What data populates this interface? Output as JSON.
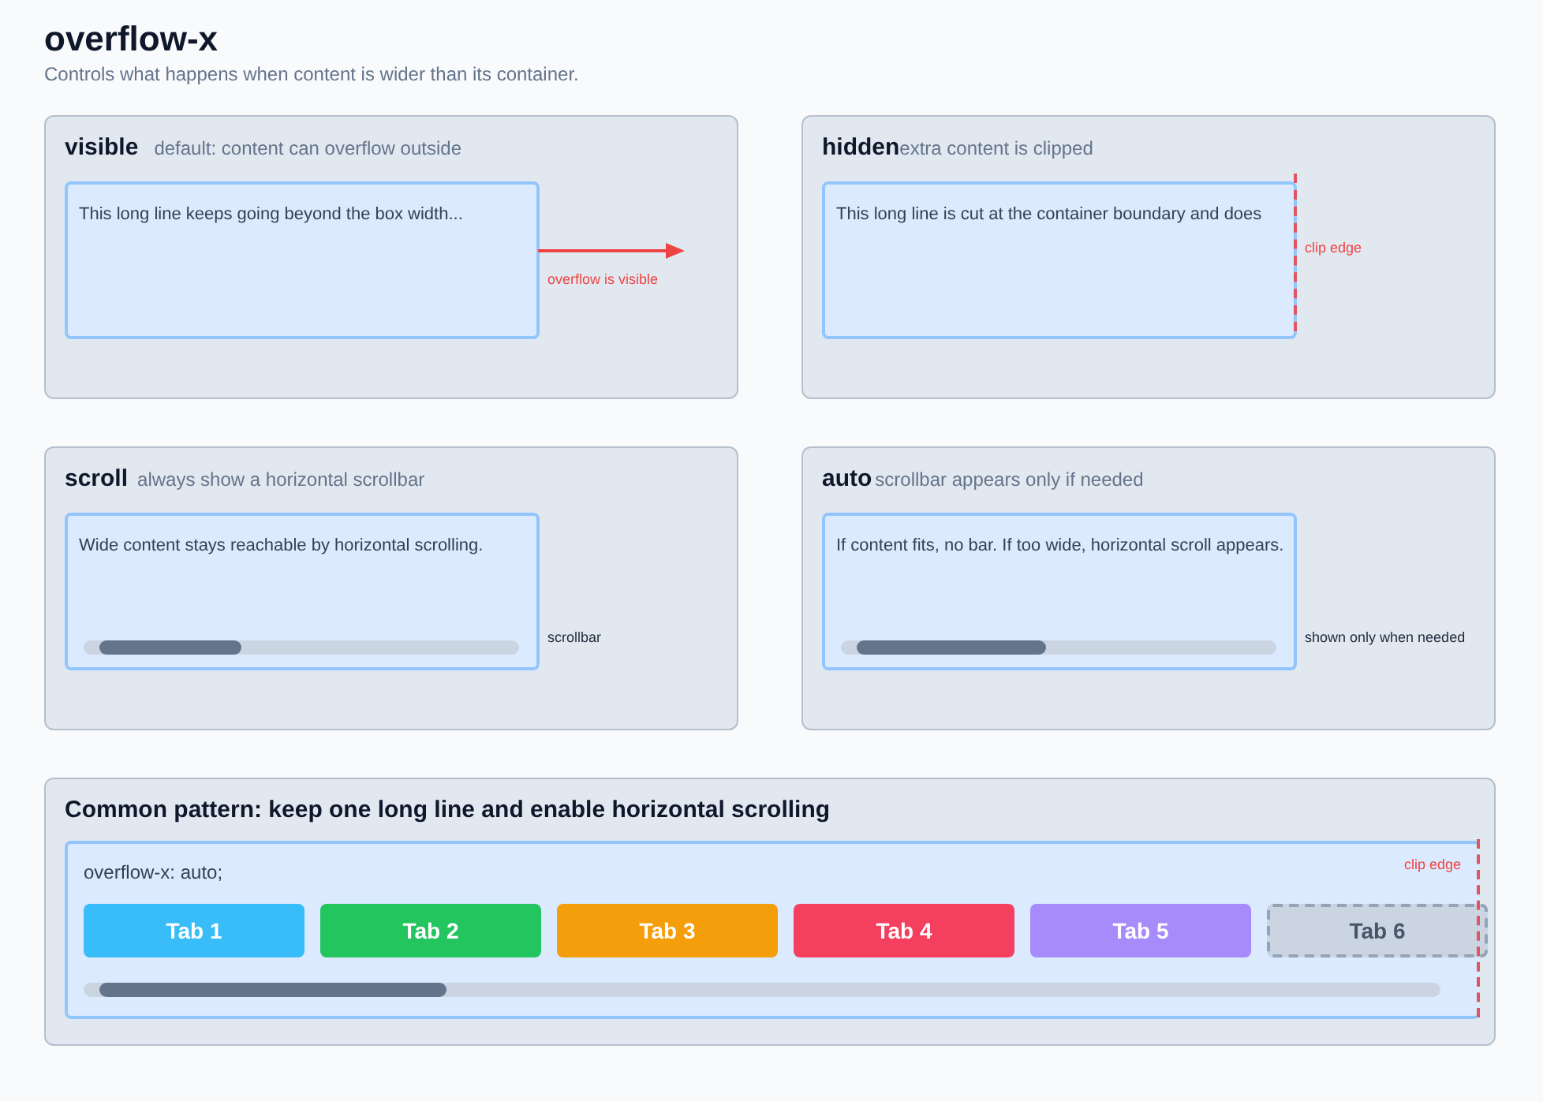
{
  "page": {
    "title": "overflow-x",
    "subtitle": "Controls what happens when content is wider than its container."
  },
  "cards": [
    {
      "kind": "visible",
      "value": "visible",
      "description": "default: content can overflow outside",
      "content": "This long line keeps going beyond the box width...",
      "annotation": "overflow is visible"
    },
    {
      "kind": "hidden",
      "value": "hidden",
      "description": "extra content is clipped",
      "content": "This long line is cut at the container boundary and does",
      "annotation": "clip edge"
    },
    {
      "kind": "scroll",
      "value": "scroll",
      "description": "always show a horizontal scrollbar",
      "content": "Wide content stays reachable by horizontal scrolling.",
      "annotation": "scrollbar"
    },
    {
      "kind": "auto",
      "value": "auto",
      "description": "scrollbar appears only if needed",
      "content": "If content fits, no bar. If too wide, horizontal scroll appears.",
      "annotation": "shown only when needed"
    }
  ],
  "pattern": {
    "title": "Common pattern: keep one long line and enable horizontal scrolling",
    "code": "overflow-x: auto;",
    "annotation": "clip edge",
    "tabs": [
      {
        "label": "Tab 1",
        "color": "#38bdf8",
        "kind": "solid"
      },
      {
        "label": "Tab 2",
        "color": "#22c55e",
        "kind": "solid"
      },
      {
        "label": "Tab 3",
        "color": "#f59e0b",
        "kind": "solid"
      },
      {
        "label": "Tab 4",
        "color": "#f43f5e",
        "kind": "solid"
      },
      {
        "label": "Tab 5",
        "color": "#a78bfa",
        "kind": "solid"
      },
      {
        "label": "Tab 6",
        "color": "#cbd5e1",
        "kind": "dashed"
      }
    ]
  }
}
